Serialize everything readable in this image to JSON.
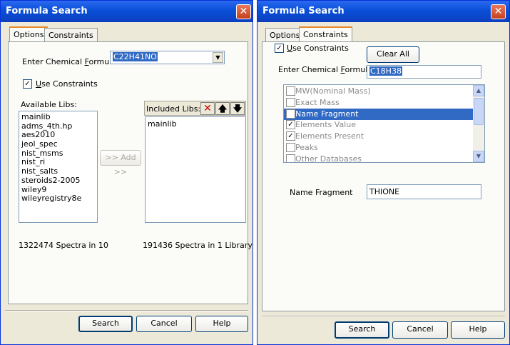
{
  "left": {
    "title": "Formula Search",
    "close_glyph": "✕",
    "tabs": [
      "Options",
      "Constraints"
    ],
    "formula_label_pre": "Enter Chemical ",
    "formula_label_u": "F",
    "formula_label_post": "ormula:",
    "formula_value": "C22H41NO",
    "use_constraints_u": "U",
    "use_constraints_rest": "se Constraints",
    "use_constraints_checked": "✓",
    "available_label": "Available Libs:",
    "available_libs": [
      "mainlib",
      "adms_4th.hp",
      "aes2010",
      "jeol_spec",
      "nist_msms",
      "nist_ri",
      "nist_salts",
      "steroids2-2005",
      "wiley9",
      "wileyregistry8e"
    ],
    "add_button": ">> Add >>",
    "included_label": "Included Libs:",
    "included_libs": [
      "mainlib"
    ],
    "icons": {
      "remove": "✕",
      "up": "🡅",
      "down": "🡇"
    },
    "spectra_available": "1322474 Spectra in 10",
    "spectra_included": "191436 Spectra in 1 Library",
    "buttons": {
      "search": "Search",
      "cancel": "Cancel",
      "help": "Help"
    }
  },
  "right": {
    "title": "Formula Search",
    "close_glyph": "✕",
    "tabs": [
      "Options",
      "Constraints"
    ],
    "use_constraints_u": "U",
    "use_constraints_rest": "se Constraints",
    "use_constraints_checked": "✓",
    "clear_all": "Clear All",
    "formula_label_pre": "Enter Chemical ",
    "formula_label_u": "F",
    "formula_label_post": "ormula:",
    "formula_value": "C18H38",
    "constraints": [
      {
        "label": "MW(Nominal Mass)",
        "checked": ""
      },
      {
        "label": "Exact Mass",
        "checked": ""
      },
      {
        "label": "Name Fragment",
        "checked": ""
      },
      {
        "label": "Elements Value",
        "checked": "✓"
      },
      {
        "label": "Elements Present",
        "checked": "✓"
      },
      {
        "label": "Peaks",
        "checked": ""
      },
      {
        "label": "Other Databases",
        "checked": ""
      }
    ],
    "scroll_up": "▲",
    "scroll_down": "▼",
    "name_fragment_label": "Name Fragment",
    "name_fragment_value": "THIONE",
    "buttons": {
      "search": "Search",
      "cancel": "Cancel",
      "help": "Help"
    }
  }
}
